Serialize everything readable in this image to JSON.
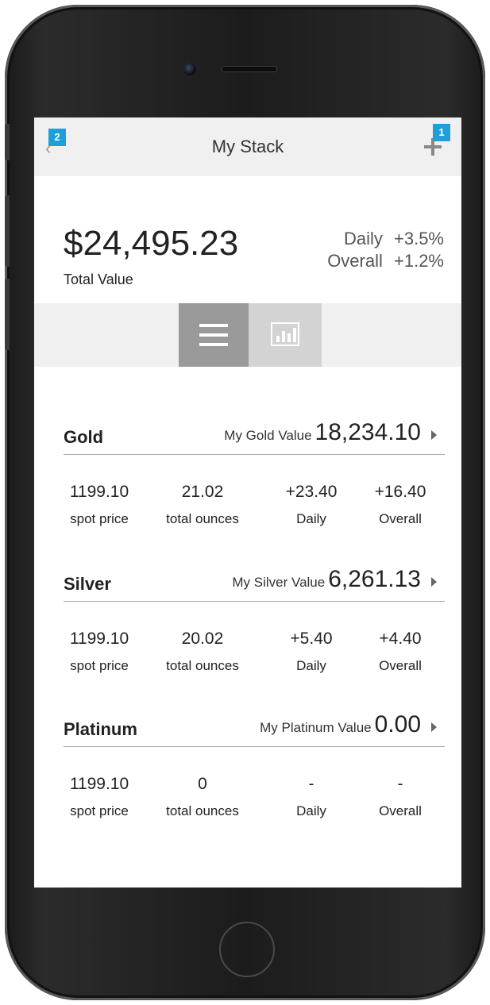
{
  "app": {
    "title": "My Stack",
    "badges": {
      "add": "1",
      "back": "2"
    }
  },
  "summary": {
    "total_value": "$24,495.23",
    "total_label": "Total Value",
    "daily_label": "Daily",
    "daily_change": "+3.5%",
    "overall_label": "Overall",
    "overall_change": "+1.2%"
  },
  "view_toggle": {
    "list_icon": "list-icon",
    "chart_icon": "bar-chart-icon",
    "selected": "list"
  },
  "metals": [
    {
      "name": "Gold",
      "value_label": "My Gold Value",
      "value": "18,234.10",
      "stats": [
        {
          "value": "1199.10",
          "label": "spot price"
        },
        {
          "value": "21.02",
          "label": "total ounces"
        },
        {
          "value": "+23.40",
          "label": "Daily"
        },
        {
          "value": "+16.40",
          "label": "Overall"
        }
      ]
    },
    {
      "name": "Silver",
      "value_label": "My Silver Value",
      "value": "6,261.13",
      "stats": [
        {
          "value": "1199.10",
          "label": "spot price"
        },
        {
          "value": "20.02",
          "label": "total ounces"
        },
        {
          "value": "+5.40",
          "label": "Daily"
        },
        {
          "value": "+4.40",
          "label": "Overall"
        }
      ]
    },
    {
      "name": "Platinum",
      "value_label": "My Platinum Value",
      "value": "0.00",
      "stats": [
        {
          "value": "1199.10",
          "label": "spot price"
        },
        {
          "value": "0",
          "label": "total ounces"
        },
        {
          "value": "-",
          "label": "Daily"
        },
        {
          "value": "-",
          "label": "Overall"
        }
      ]
    }
  ],
  "colors": {
    "badge": "#1e9fd8",
    "nav_background": "#f0f0f0",
    "toggle_selected": "#9a9a9a",
    "toggle_unselected": "#d3d3d3"
  }
}
